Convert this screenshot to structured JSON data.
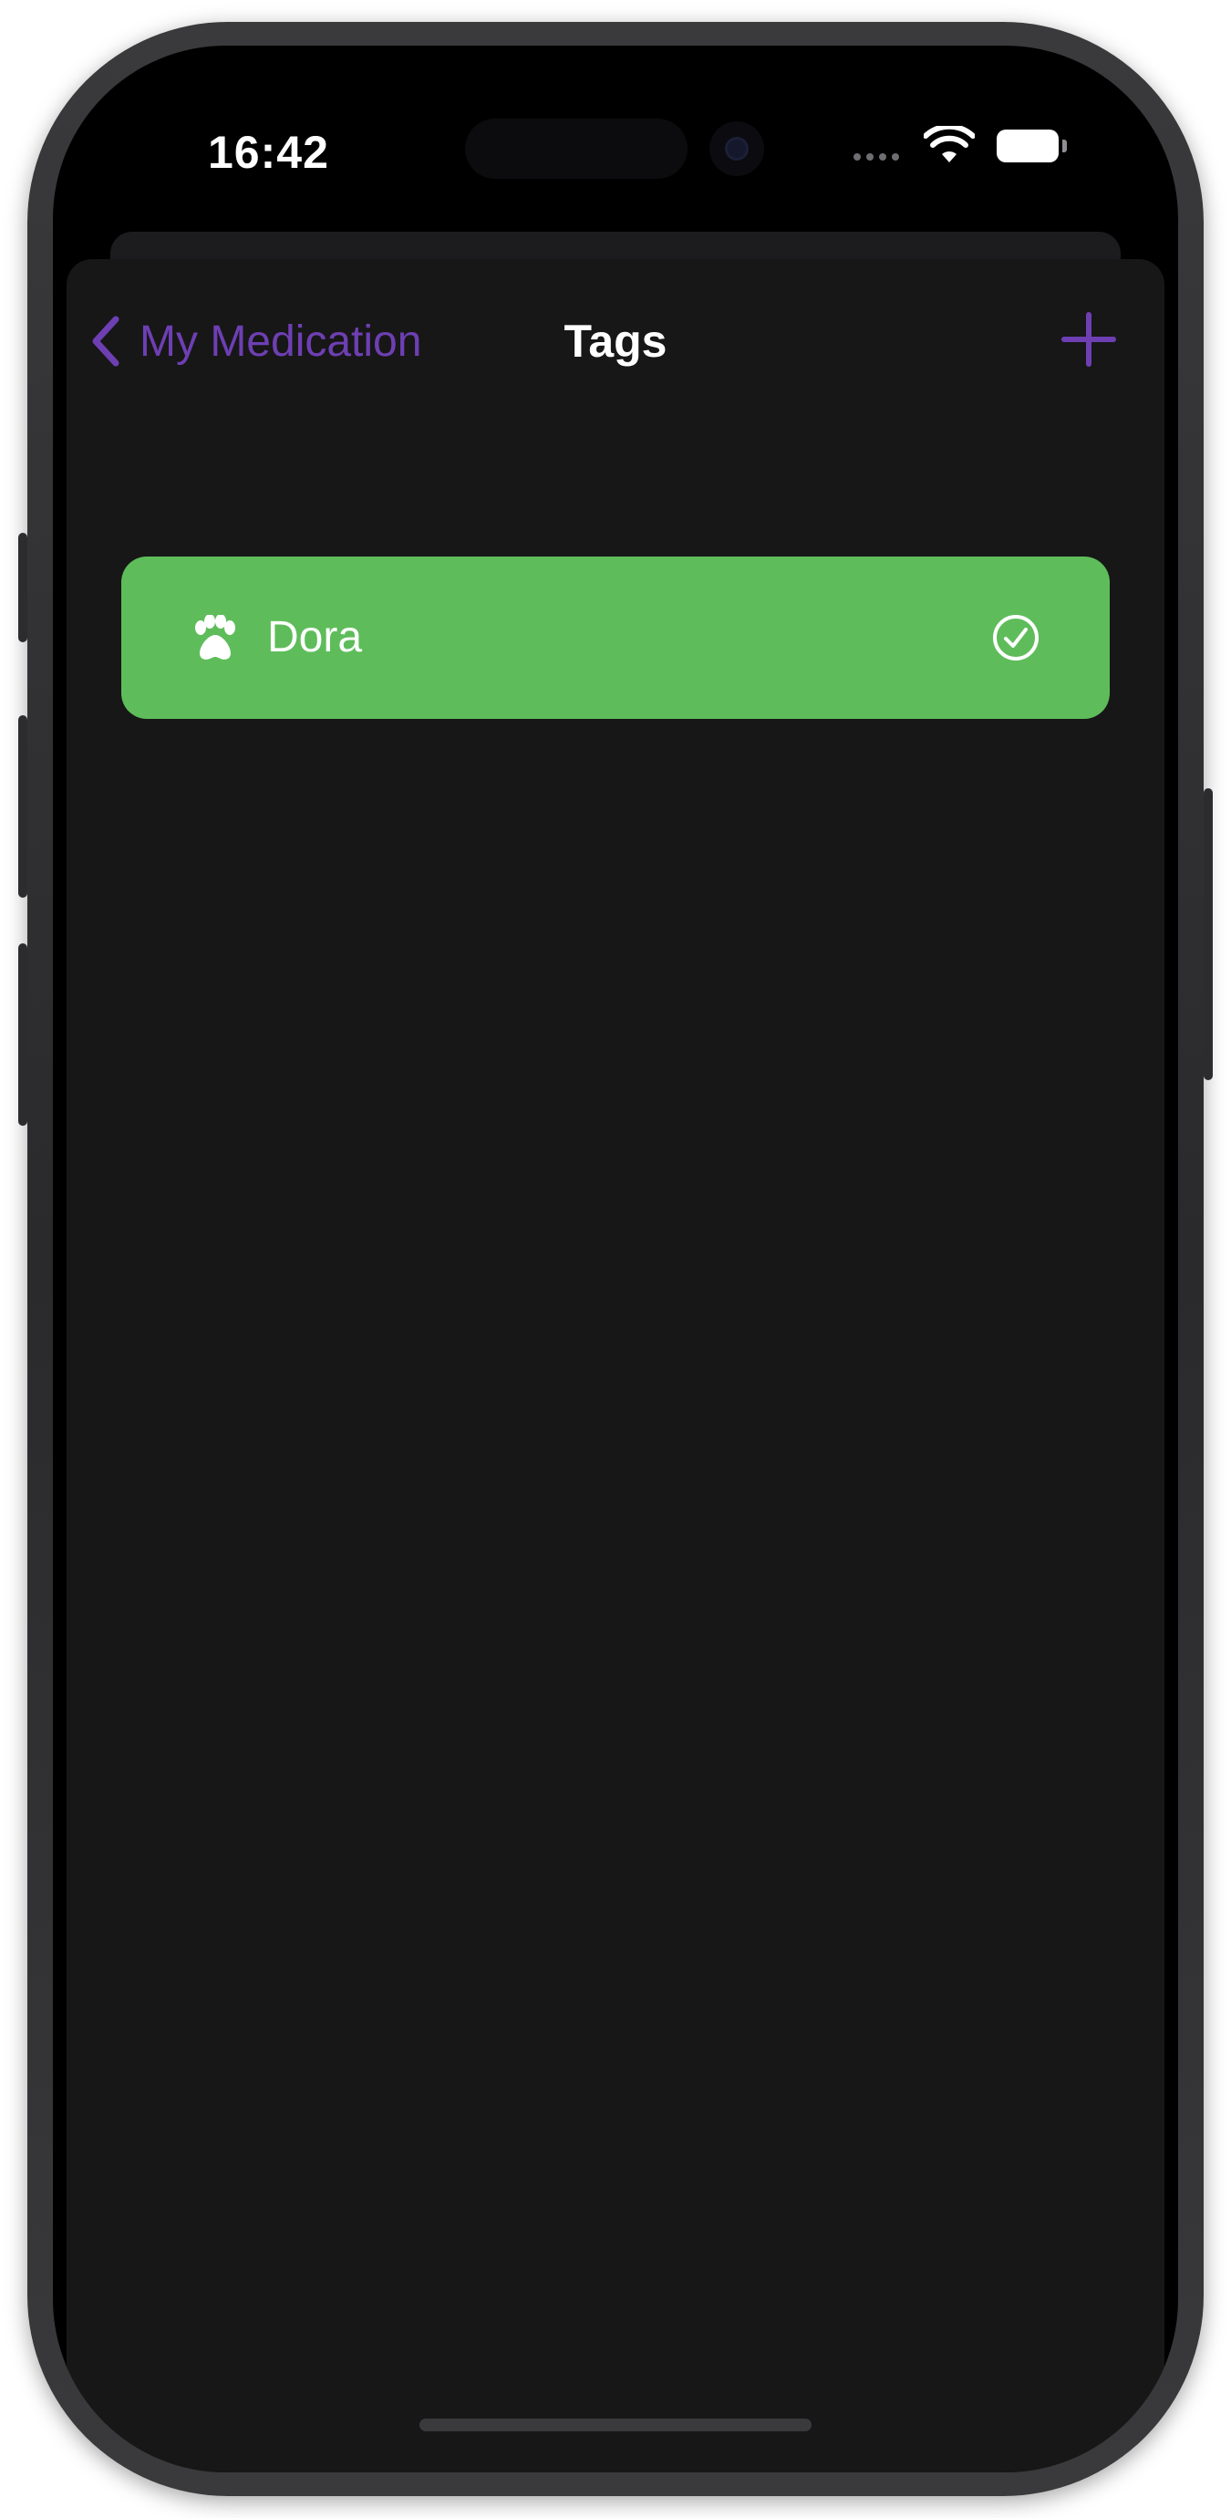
{
  "status_bar": {
    "time": "16:42",
    "signal_icon": "signal-dots-icon",
    "wifi_icon": "wifi-icon",
    "battery_icon": "battery-icon"
  },
  "nav": {
    "back_label": "My Medication",
    "back_icon": "chevron-left-icon",
    "title": "Tags",
    "add_icon": "plus-icon"
  },
  "tags": [
    {
      "label": "Dora",
      "icon": "paw-icon",
      "selected": true,
      "selected_icon": "checkmark-circle-icon",
      "color": "#5ebd5a"
    }
  ],
  "colors": {
    "accent": "#6e3fb3",
    "sheet_background": "#171717",
    "tag_green": "#5ebd5a"
  }
}
